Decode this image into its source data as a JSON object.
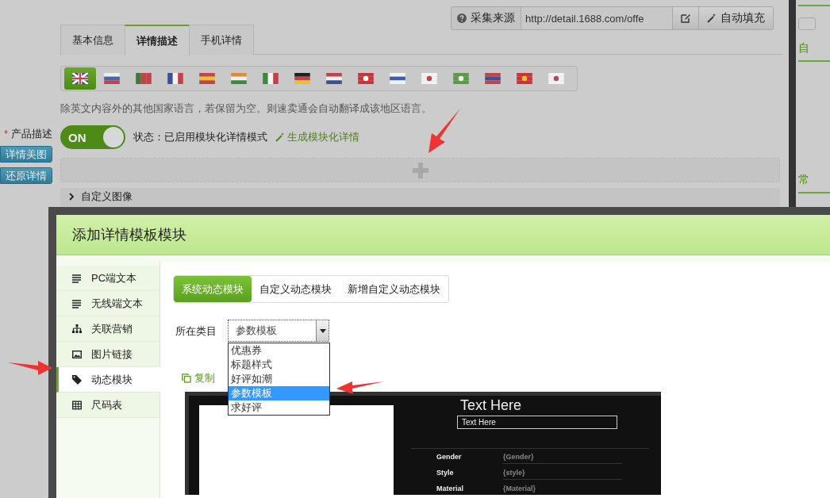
{
  "source_bar": {
    "label": "采集来源",
    "url": "http://detail.1688.com/offe",
    "fill_button": "自动填充"
  },
  "tabs": [
    {
      "label": "基本信息",
      "selected": false
    },
    {
      "label": "详情描述",
      "selected": true
    },
    {
      "label": "手机详情",
      "selected": false
    }
  ],
  "languages": [
    {
      "selected": true
    },
    {
      "selected": false
    },
    {
      "selected": false
    },
    {
      "selected": false
    },
    {
      "selected": false
    },
    {
      "selected": false
    },
    {
      "selected": false
    },
    {
      "selected": false
    },
    {
      "selected": false
    },
    {
      "selected": false
    },
    {
      "selected": false
    },
    {
      "selected": false
    },
    {
      "selected": false
    },
    {
      "selected": false
    },
    {
      "selected": false
    },
    {
      "selected": false
    }
  ],
  "hint": "除英文内容外的其他国家语言，若保留为空。则速卖通会自动翻译成该地区语言。",
  "product_description": {
    "required_mark": "*",
    "label": "产品描述"
  },
  "side_buttons": [
    "详情美图",
    "还原详情"
  ],
  "toggle": {
    "label": "ON",
    "on": true
  },
  "status": "状态：已启用模块化详情模式",
  "generate_link": "生成模块化详情",
  "modules": [
    {
      "title": "自定义图像"
    }
  ],
  "right_panel": {
    "texts": [
      "自",
      "常"
    ]
  },
  "dialog": {
    "title": "添加详情模板模块",
    "menu": [
      {
        "label": "PC端文本",
        "selected": false
      },
      {
        "label": "无线端文本",
        "selected": false
      },
      {
        "label": "关联营销",
        "selected": false
      },
      {
        "label": "图片链接",
        "selected": false
      },
      {
        "label": "动态模块",
        "selected": true
      },
      {
        "label": "尺码表",
        "selected": false
      }
    ],
    "subtabs": [
      {
        "label": "系统动态模块",
        "selected": true
      },
      {
        "label": "自定义动态模块",
        "selected": false
      },
      {
        "label": "新增自定义动态模块",
        "selected": false
      }
    ],
    "category": {
      "label": "所在类目",
      "value": "参数模板",
      "options": [
        {
          "label": "优惠券",
          "selected": false
        },
        {
          "label": "标题样式",
          "selected": false
        },
        {
          "label": "好评如潮",
          "selected": false
        },
        {
          "label": "参数模板",
          "selected": true
        },
        {
          "label": "求好评",
          "selected": false
        }
      ]
    },
    "copy": "复制",
    "preview": {
      "heading": "Text Here",
      "field": "Text Here",
      "rows": [
        {
          "name": "Gender",
          "value": "{Gender}"
        },
        {
          "name": "Style",
          "value": "{style}"
        },
        {
          "name": "Material",
          "value": "{Material}"
        }
      ]
    }
  }
}
